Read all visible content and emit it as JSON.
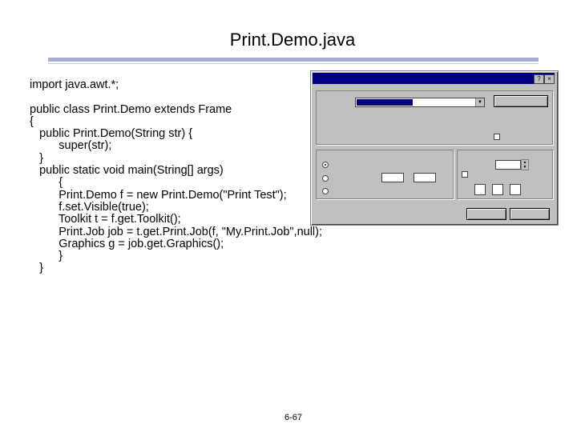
{
  "slide": {
    "title": "Print.Demo.java",
    "page_number": "6-67"
  },
  "code_lines": [
    "import java.awt.*;",
    "",
    "public class Print.Demo extends Frame",
    "{",
    "   public Print.Demo(String str) {",
    "         super(str);",
    "   }",
    "   public static void main(String[] args)",
    "         {",
    "         Print.Demo f = new Print.Demo(\"Print Test\");",
    "         f.set.Visible(true);",
    "         Toolkit t = f.get.Toolkit();",
    "         Print.Job job = t.get.Print.Job(f, \"My.Print.Job\",null);",
    "         Graphics g = job.get.Graphics();",
    "         }",
    "   }"
  ]
}
